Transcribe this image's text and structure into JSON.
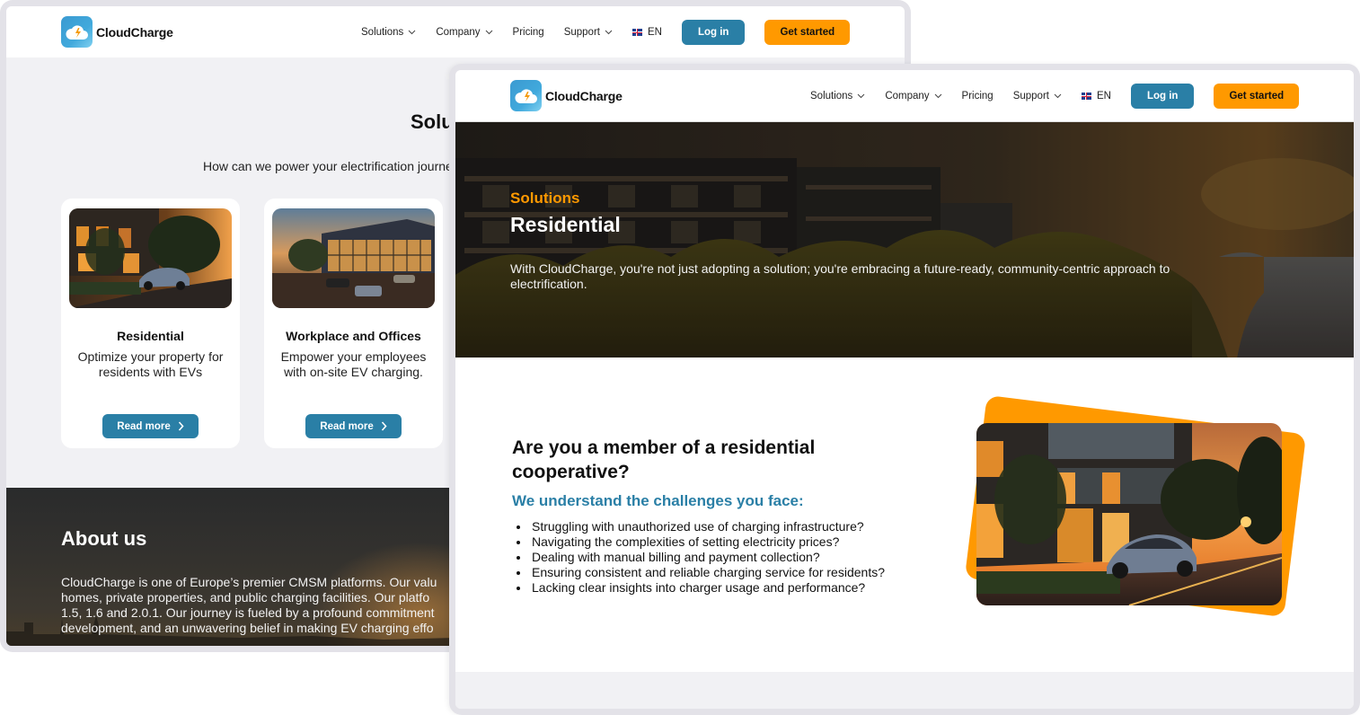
{
  "brand": {
    "name": "CloudCharge",
    "logo_icon": "cloud-bolt-icon",
    "colors": {
      "primary": "#2a7fa6",
      "accent": "#ff9900",
      "logo": "#41a9dc"
    }
  },
  "nav": {
    "items": [
      {
        "label": "Solutions",
        "has_dropdown": true
      },
      {
        "label": "Company",
        "has_dropdown": true
      },
      {
        "label": "Pricing",
        "has_dropdown": false
      },
      {
        "label": "Support",
        "has_dropdown": true
      }
    ],
    "language": {
      "flag": "uk-flag-icon",
      "label": "EN"
    },
    "login_label": "Log in",
    "get_started_label": "Get started"
  },
  "back_page": {
    "title": "Solutions",
    "subtitle": "How can we power your electrification journey?",
    "cards": [
      {
        "title": "Residential",
        "description": "Optimize your property for residents with EVs",
        "button": "Read more"
      },
      {
        "title": "Workplace and Offices",
        "description": "Empower your employees with on-site EV charging.",
        "button": "Read more"
      }
    ],
    "about": {
      "title": "About us",
      "text": "CloudCharge is one of Europe’s premier CMSM platforms. Our valu\nhomes, private properties, and public charging facilities. Our platfo\n1.5, 1.6 and 2.0.1. Our journey is fueled by a profound commitment\ndevelopment, and an unwavering belief in making EV charging effo"
    }
  },
  "front_page": {
    "hero": {
      "eyebrow": "Solutions",
      "title": "Residential",
      "text": "With CloudCharge, you're not just adopting a solution; you're embracing a future-ready, community-centric approach to electrification."
    },
    "section": {
      "title": "Are you a member of a residential cooperative?",
      "subtitle": "We understand the challenges you face:",
      "challenges": [
        "Struggling with unauthorized use of charging infrastructure?",
        "Navigating the complexities of setting electricity prices?",
        "Dealing with manual billing and payment collection?",
        "Ensuring consistent and reliable charging service for residents?",
        "Lacking clear insights into charger usage and performance?"
      ]
    }
  }
}
